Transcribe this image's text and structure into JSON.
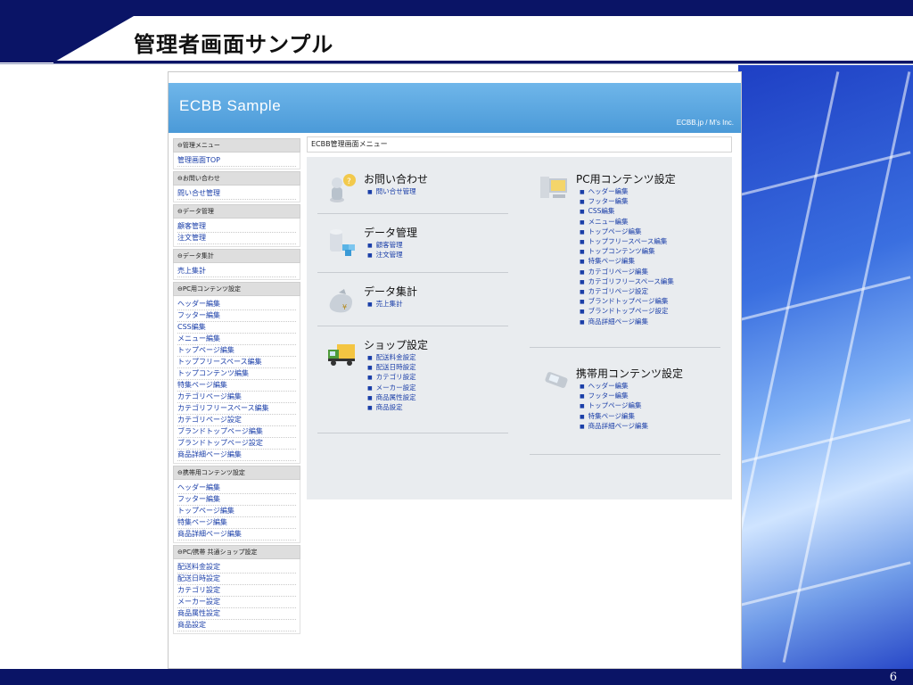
{
  "slide": {
    "title": "管理者画面サンプル",
    "page_number": "6"
  },
  "app": {
    "brand": "ECBB Sample",
    "credit": "ECBB.jp / M's Inc."
  },
  "sidebar": [
    {
      "heading": "⊖管理メニュー",
      "items": [
        "管理画面TOP"
      ]
    },
    {
      "heading": "⊖お問い合わせ",
      "items": [
        "問い合せ管理"
      ]
    },
    {
      "heading": "⊖データ管理",
      "items": [
        "顧客管理",
        "注文管理"
      ]
    },
    {
      "heading": "⊖データ集計",
      "items": [
        "売上集計"
      ]
    },
    {
      "heading": "⊖PC用コンテンツ設定",
      "items": [
        "ヘッダー編集",
        "フッター編集",
        "CSS編集",
        "メニュー編集",
        "トップページ編集",
        "トップフリースペース編集",
        "トップコンテンツ編集",
        "特集ページ編集",
        "カテゴリページ編集",
        "カテゴリフリースペース編集",
        "カテゴリページ設定",
        "ブランドトップページ編集",
        "ブランドトップページ設定",
        "商品詳細ページ編集"
      ]
    },
    {
      "heading": "⊖携帯用コンテンツ設定",
      "items": [
        "ヘッダー編集",
        "フッター編集",
        "トップページ編集",
        "特集ページ編集",
        "商品詳細ページ編集"
      ]
    },
    {
      "heading": "⊖PC/携帯 共通ショップ設定",
      "items": [
        "配送料金設定",
        "配送日時設定",
        "カテゴリ設定",
        "メーカー設定",
        "商品属性設定",
        "商品設定"
      ]
    }
  ],
  "main": {
    "heading": "ECBB管理画面メニュー",
    "blocks": [
      {
        "title": "お問い合わせ",
        "icon": "support-person-icon",
        "links": [
          "問い合せ管理"
        ]
      },
      {
        "title": "データ管理",
        "icon": "database-icon",
        "links": [
          "顧客管理",
          "注文管理"
        ]
      },
      {
        "title": "データ集計",
        "icon": "money-bag-icon",
        "links": [
          "売上集計"
        ]
      },
      {
        "title": "ショップ設定",
        "icon": "delivery-truck-icon",
        "links": [
          "配送料金設定",
          "配送日時設定",
          "カテゴリ設定",
          "メーカー設定",
          "商品属性設定",
          "商品設定"
        ]
      },
      {
        "title": "PC用コンテンツ設定",
        "icon": "desktop-pc-icon",
        "links": [
          "ヘッダー編集",
          "フッター編集",
          "CSS編集",
          "メニュー編集",
          "トップページ編集",
          "トップフリースペース編集",
          "トップコンテンツ編集",
          "特集ページ編集",
          "カテゴリページ編集",
          "カテゴリフリースペース編集",
          "カテゴリページ設定",
          "ブランドトップページ編集",
          "ブランドトップページ設定",
          "商品詳細ページ編集"
        ]
      },
      {
        "title": "携帯用コンテンツ設定",
        "icon": "mobile-phone-icon",
        "links": [
          "ヘッダー編集",
          "フッター編集",
          "トップページ編集",
          "特集ページ編集",
          "商品詳細ページ編集"
        ]
      }
    ]
  },
  "colors": {
    "slide_band": "#0a1466",
    "header_blue": "#4b9ad8",
    "link_blue": "#1a3ea8",
    "panel_bg": "#e9ecef"
  }
}
